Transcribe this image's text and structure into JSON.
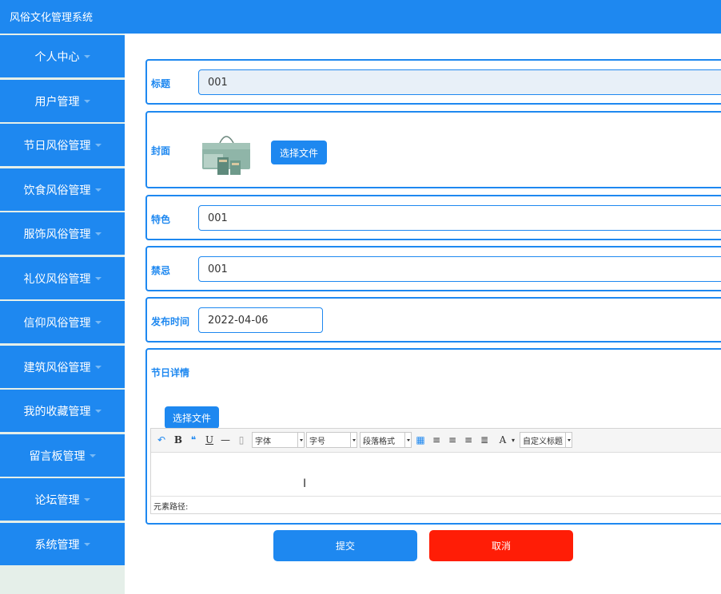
{
  "header": {
    "app_title": "风俗文化管理系统"
  },
  "sidebar": {
    "items": [
      {
        "label": "个人中心"
      },
      {
        "label": "用户管理"
      },
      {
        "label": "节日风俗管理"
      },
      {
        "label": "饮食风俗管理"
      },
      {
        "label": "服饰风俗管理"
      },
      {
        "label": "礼仪风俗管理"
      },
      {
        "label": "信仰风俗管理"
      },
      {
        "label": "建筑风俗管理"
      },
      {
        "label": "我的收藏管理"
      },
      {
        "label": "留言板管理"
      },
      {
        "label": "论坛管理"
      },
      {
        "label": "系统管理"
      }
    ]
  },
  "form": {
    "title": {
      "label": "标题",
      "value": "001"
    },
    "cover": {
      "label": "封面",
      "button": "选择文件"
    },
    "feature": {
      "label": "特色",
      "value": "001"
    },
    "taboo": {
      "label": "禁忌",
      "value": "001"
    },
    "publish_time": {
      "label": "发布时间",
      "value": "2022-04-06"
    },
    "details": {
      "label": "节日详情",
      "button": "选择文件",
      "toolbar": {
        "font_family": "字体",
        "font_size": "字号",
        "paragraph": "段落格式",
        "custom_title": "自定义标题",
        "bold": "B",
        "underline": "U",
        "font_color": "A"
      },
      "path_label": "元素路径:"
    }
  },
  "actions": {
    "submit": "提交",
    "cancel": "取消"
  },
  "colors": {
    "primary": "#1e88f0",
    "danger": "#ff1d06",
    "sidebar_bg": "#e5efe9"
  }
}
